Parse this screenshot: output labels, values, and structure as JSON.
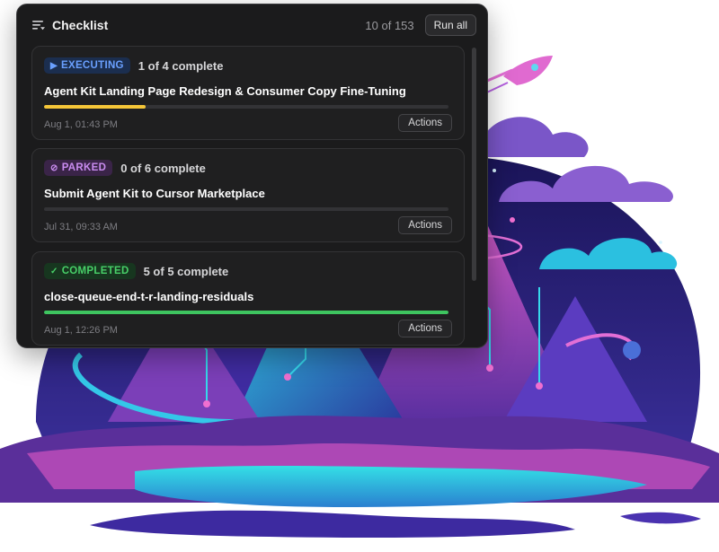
{
  "checklist": {
    "title": "Checklist",
    "count": "10 of 153",
    "run_all_label": "Run all",
    "icon": "list-filter-icon"
  },
  "tasks": [
    {
      "status": "EXECUTING",
      "status_icon": "play-icon",
      "status_color": "#5b8def",
      "progress_text": "1 of 4 complete",
      "progress_fraction": 0.25,
      "progress_color": "#f5c638",
      "title": "Agent Kit Landing Page Redesign & Consumer Copy Fine-Tuning",
      "date": "Aug 1, 01:43 PM",
      "actions_label": "Actions"
    },
    {
      "status": "PARKED",
      "status_icon": "ban-icon",
      "status_color": "#b57be8",
      "progress_text": "0 of 6 complete",
      "progress_fraction": 0,
      "progress_color": "#b57be8",
      "title": "Submit Agent Kit to Cursor Marketplace",
      "date": "Jul 31, 09:33 AM",
      "actions_label": "Actions"
    },
    {
      "status": "COMPLETED",
      "status_icon": "check-icon",
      "status_color": "#3ec45f",
      "progress_text": "5 of 5 complete",
      "progress_fraction": 1,
      "progress_color": "#3ec45f",
      "title": "close-queue-end-t-r-landing-residuals",
      "date": "Aug 1, 12:26 PM",
      "actions_label": "Actions"
    }
  ]
}
